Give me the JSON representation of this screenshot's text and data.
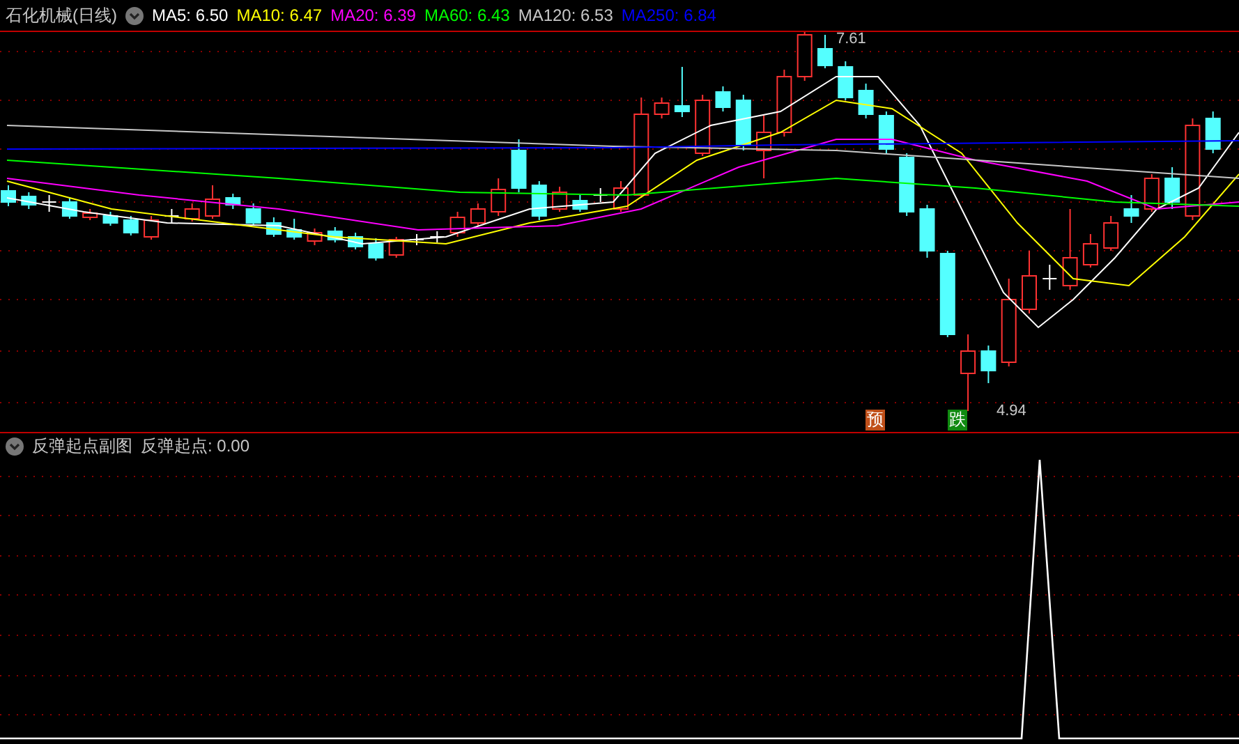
{
  "title": "石化机械(日线)",
  "ma_legend": [
    {
      "label": "MA5: 6.50",
      "color": "#ffffff"
    },
    {
      "label": "MA10: 6.47",
      "color": "#ffff00"
    },
    {
      "label": "MA20: 6.39",
      "color": "#ff00ff"
    },
    {
      "label": "MA60: 6.43",
      "color": "#00ff00"
    },
    {
      "label": "MA120: 6.53",
      "color": "#c8c8c8"
    },
    {
      "label": "MA250: 6.84",
      "color": "#0000ff"
    }
  ],
  "price_marks": [
    {
      "label": "7.61"
    },
    {
      "label": "4.94"
    }
  ],
  "signals": [
    {
      "label": "预",
      "color": "#c0501a"
    },
    {
      "label": "跌",
      "color": "#108a10"
    }
  ],
  "indicator": {
    "title": "反弹起点副图",
    "reading": "反弹起点: 0.00"
  }
}
